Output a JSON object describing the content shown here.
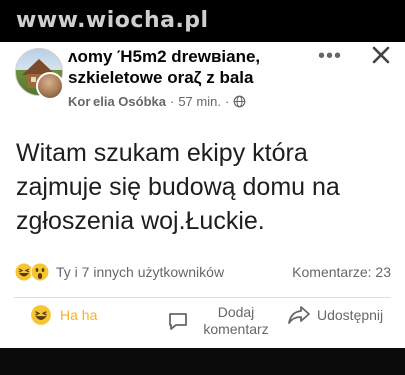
{
  "watermark": {
    "text": "www.wiocha.pl"
  },
  "post": {
    "group_name": "ʌomy Ή5m2 drewʙiane, szkieletowe oraζ z bala",
    "author": "Kor elia Osóbka",
    "separator": "·",
    "time": "57 min.",
    "visibility_icon": "globe-icon",
    "text": "Witam szukam ekipy która zajmuje się budową domu na zgłoszenia woj.Łuckie.",
    "reactions": {
      "icons": [
        "haha-emoji",
        "wow-emoji"
      ],
      "summary": "Ty i 7 innych użytkowników"
    },
    "comments": "Komentarze: 23",
    "actions": {
      "haha": "Ha ha",
      "comment": "Dodaj komentarz",
      "share": "Udostępnij"
    }
  },
  "colors": {
    "haha_accent": "#f7b125",
    "secondary_text": "#65676b",
    "primary_text": "#1c1e21",
    "background": "#ffffff"
  }
}
